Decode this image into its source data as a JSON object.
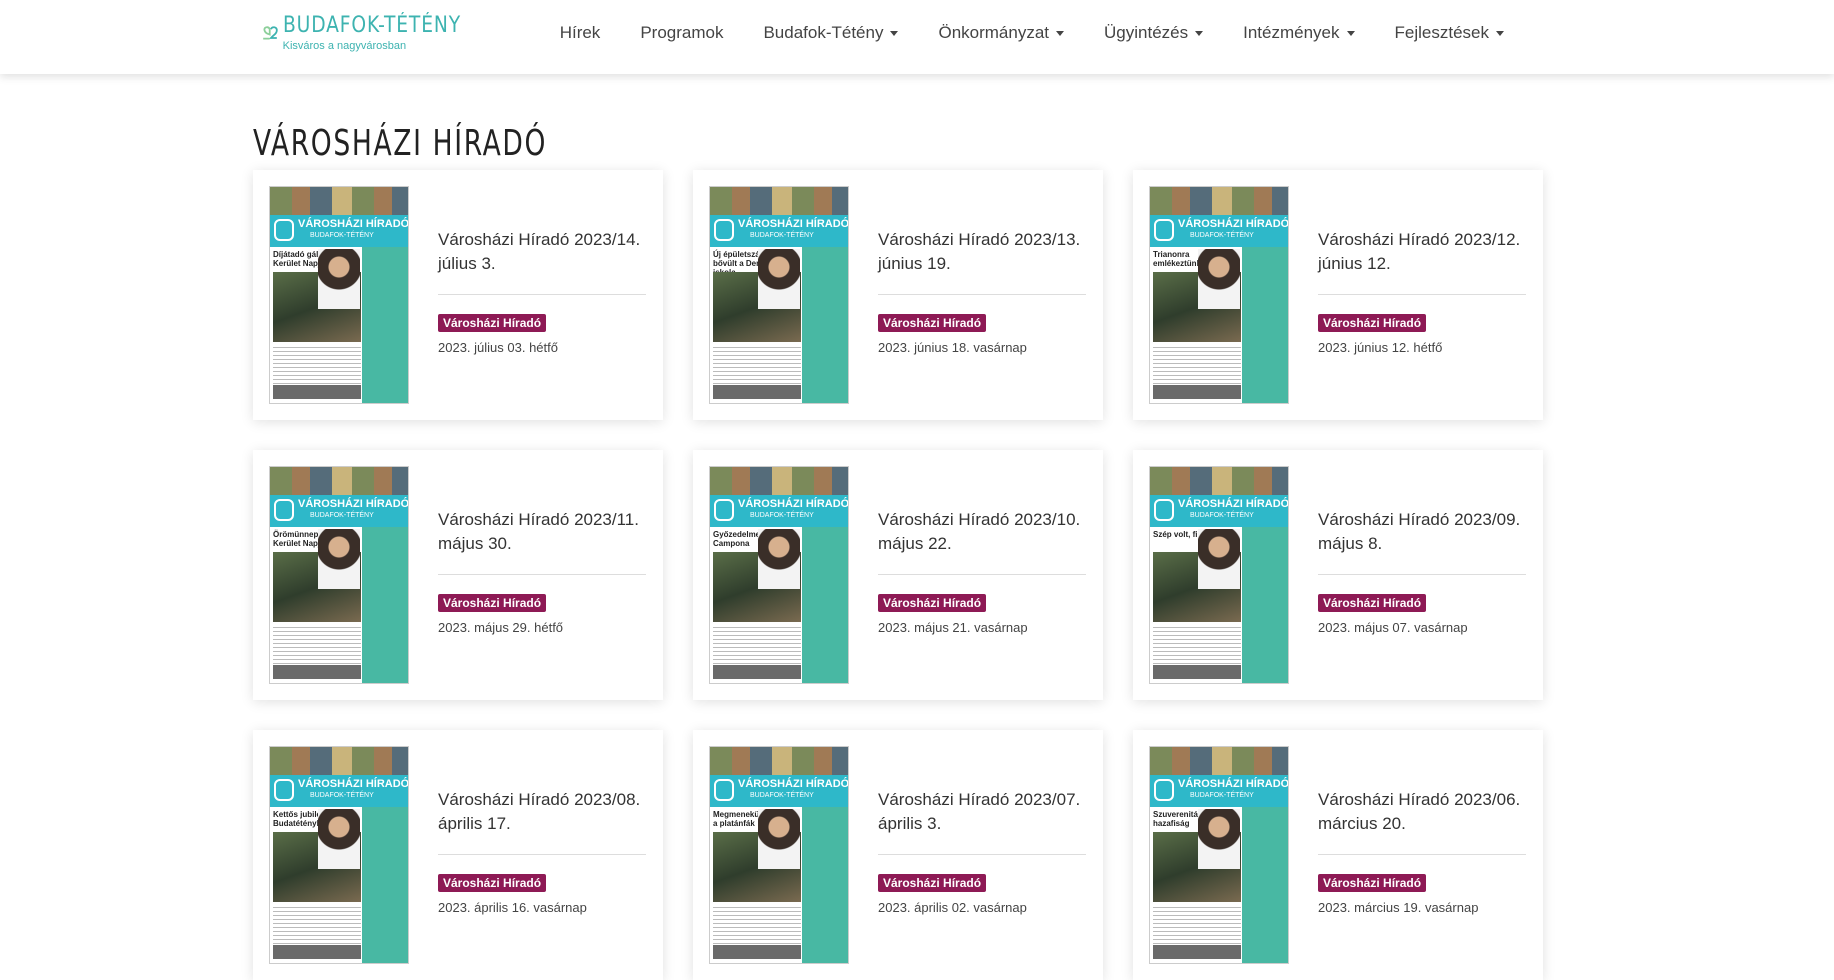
{
  "brand": {
    "name": "BUDAFOK-TÉTÉNY",
    "tagline": "Kisváros a nagyvárosban",
    "color": "#3db3b0"
  },
  "nav": [
    {
      "label": "Hírek",
      "dropdown": false
    },
    {
      "label": "Programok",
      "dropdown": false
    },
    {
      "label": "Budafok-Tétény",
      "dropdown": true
    },
    {
      "label": "Önkormányzat",
      "dropdown": true
    },
    {
      "label": "Ügyintézés",
      "dropdown": true
    },
    {
      "label": "Intézmények",
      "dropdown": true
    },
    {
      "label": "Fejlesztések",
      "dropdown": true
    }
  ],
  "page_title": "VÁROSHÁZI HÍRADÓ",
  "badge_color": "#8e1a55",
  "cover": {
    "masthead": "VÁROSHÁZI HÍRADÓ",
    "sub": "BUDAFOK-TÉTÉNY"
  },
  "cards": [
    {
      "title": "Városházi Híradó 2023/14. július 3.",
      "category": "Városházi Híradó",
      "date": "2023. július 03. hétfő",
      "cover_headline": "Díjátadó gála a Kerület Napján"
    },
    {
      "title": "Városházi Híradó 2023/13. június 19.",
      "category": "Városházi Híradó",
      "date": "2023. június 18. vasárnap",
      "cover_headline": "Új épületszárnnyal bővült a Dernjén iskola"
    },
    {
      "title": "Városházi Híradó 2023/12. június 12.",
      "category": "Városházi Híradó",
      "date": "2023. június 12. hétfő",
      "cover_headline": "Trianonra emlékeztünk"
    },
    {
      "title": "Városházi Híradó 2023/11. május 30.",
      "category": "Városházi Híradó",
      "date": "2023. május 29. hétfő",
      "cover_headline": "Örömünnep a Kerület Napján"
    },
    {
      "title": "Városházi Híradó 2023/10. május 22.",
      "category": "Városházi Híradó",
      "date": "2023. május 21. vasárnap",
      "cover_headline": "Győzedelmes Campona"
    },
    {
      "title": "Városházi Híradó 2023/09. május 8.",
      "category": "Városházi Híradó",
      "date": "2023. május 07. vasárnap",
      "cover_headline": "Szép volt, fiúk!"
    },
    {
      "title": "Városházi Híradó 2023/08. április 17.",
      "category": "Városházi Híradó",
      "date": "2023. április 16. vasárnap",
      "cover_headline": "Kettős jubileum Budatétényben"
    },
    {
      "title": "Városházi Híradó 2023/07. április 3.",
      "category": "Városházi Híradó",
      "date": "2023. április 02. vasárnap",
      "cover_headline": "Megmenekülhetnek a platánfák"
    },
    {
      "title": "Városházi Híradó 2023/06. március 20.",
      "category": "Városházi Híradó",
      "date": "2023. március 19. vasárnap",
      "cover_headline": "Szuverenitás és hazafiság"
    }
  ]
}
